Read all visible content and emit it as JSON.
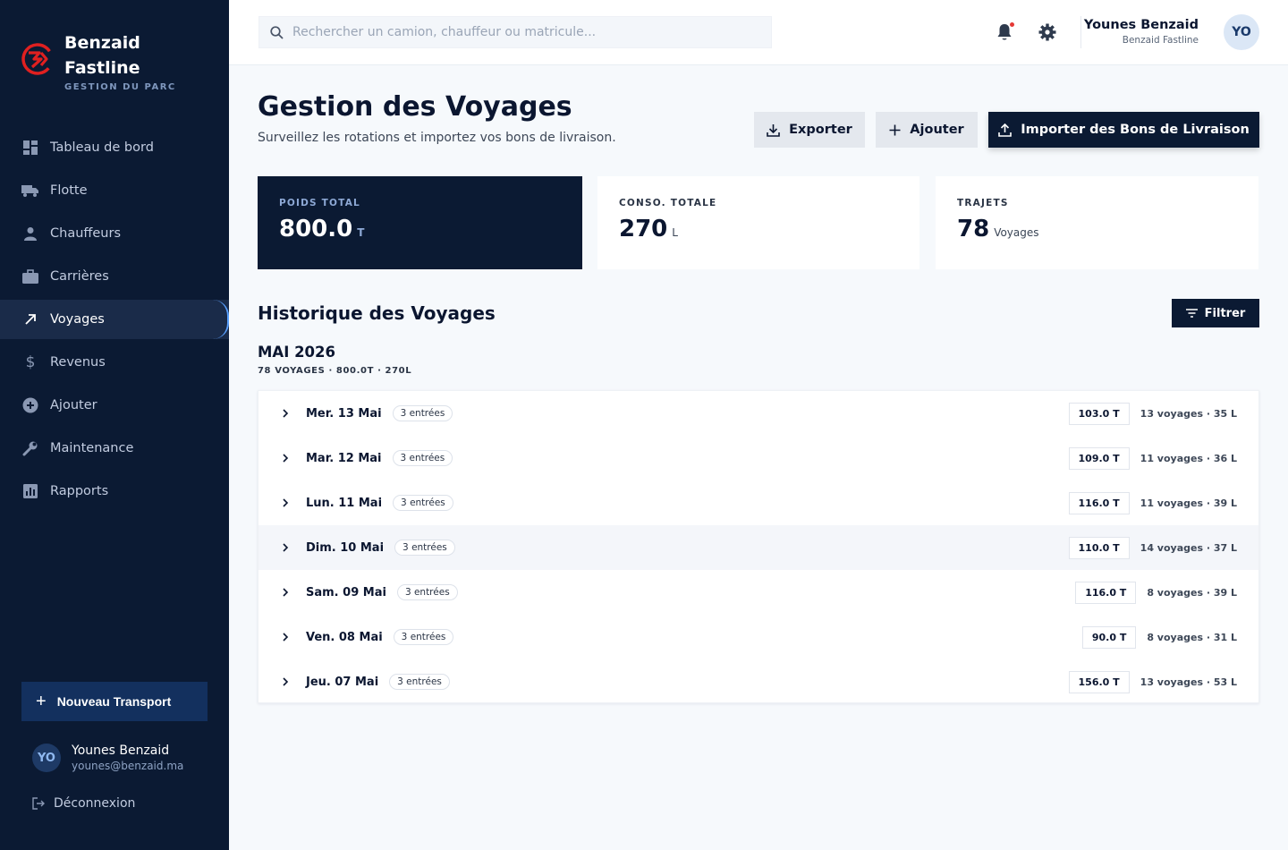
{
  "brand": {
    "name_line1": "Benzaid",
    "name_line2": "Fastline",
    "subtitle": "GESTION DU PARC",
    "accent": "#e02020"
  },
  "nav": {
    "items": [
      {
        "label": "Tableau de bord",
        "icon": "dashboard-icon"
      },
      {
        "label": "Flotte",
        "icon": "truck-icon"
      },
      {
        "label": "Chauffeurs",
        "icon": "person-icon"
      },
      {
        "label": "Carrières",
        "icon": "briefcase-icon"
      },
      {
        "label": "Voyages",
        "icon": "arrow-up-right-icon",
        "active": true
      },
      {
        "label": "Revenus",
        "icon": "dollar-icon"
      },
      {
        "label": "Ajouter",
        "icon": "add-circle-icon"
      },
      {
        "label": "Maintenance",
        "icon": "wrench-icon"
      },
      {
        "label": "Rapports",
        "icon": "bar-chart-icon"
      }
    ],
    "new_transport": "Nouveau Transport"
  },
  "sidebar_user": {
    "initials": "YO",
    "name": "Younes Benzaid",
    "email": "younes@benzaid.ma",
    "logout": "Déconnexion"
  },
  "topbar": {
    "search_placeholder": "Rechercher un camion, chauffeur ou matricule...",
    "user_name": "Younes Benzaid",
    "user_company": "Benzaid Fastline",
    "initials": "YO"
  },
  "header": {
    "title": "Gestion des Voyages",
    "subtitle": "Surveillez les rotations et importez vos bons de livraison.",
    "export": "Exporter",
    "add": "Ajouter",
    "import": "Importer des Bons de Livraison"
  },
  "stats": [
    {
      "label": "POIDS TOTAL",
      "value": "800.0",
      "unit": "T"
    },
    {
      "label": "CONSO. TOTALE",
      "value": "270",
      "unit": "L"
    },
    {
      "label": "TRAJETS",
      "value": "78",
      "unit": "Voyages"
    }
  ],
  "history": {
    "title": "Historique des Voyages",
    "filter": "Filtrer",
    "month": "MAI 2026",
    "summary": "78 VOYAGES · 800.0T · 270L",
    "rows": [
      {
        "date": "Mer. 13 Mai",
        "entries": "3 entrées",
        "weight": "103.0 T",
        "meta": "13 voyages · 35 L"
      },
      {
        "date": "Mar. 12 Mai",
        "entries": "3 entrées",
        "weight": "109.0 T",
        "meta": "11 voyages · 36 L"
      },
      {
        "date": "Lun. 11 Mai",
        "entries": "3 entrées",
        "weight": "116.0 T",
        "meta": "11 voyages · 39 L"
      },
      {
        "date": "Dim. 10 Mai",
        "entries": "3 entrées",
        "weight": "110.0 T",
        "meta": "14 voyages · 37 L"
      },
      {
        "date": "Sam. 09 Mai",
        "entries": "3 entrées",
        "weight": "116.0 T",
        "meta": "8 voyages · 39 L"
      },
      {
        "date": "Ven. 08 Mai",
        "entries": "3 entrées",
        "weight": "90.0 T",
        "meta": "8 voyages · 31 L"
      },
      {
        "date": "Jeu. 07 Mai",
        "entries": "3 entrées",
        "weight": "156.0 T",
        "meta": "13 voyages · 53 L"
      }
    ]
  }
}
